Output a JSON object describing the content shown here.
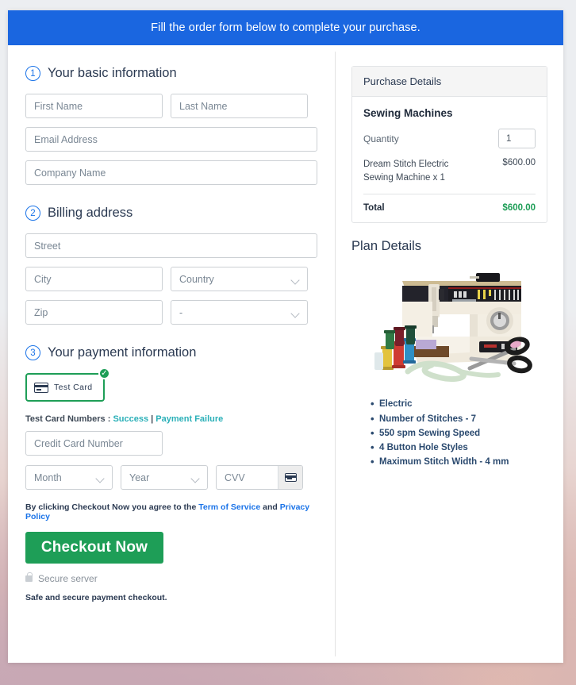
{
  "banner": {
    "text": "Fill the order form below to complete your purchase."
  },
  "sections": {
    "basic": {
      "number": "1",
      "title": "Your basic information"
    },
    "billing": {
      "number": "2",
      "title": "Billing address"
    },
    "payment": {
      "number": "3",
      "title": "Your payment information"
    }
  },
  "fields": {
    "first_name": "First Name",
    "last_name": "Last Name",
    "email": "Email Address",
    "company": "Company Name",
    "street": "Street",
    "city": "City",
    "country": "Country",
    "zip": "Zip",
    "state": "-",
    "credit_card": "Credit Card Number",
    "month": "Month",
    "year": "Year",
    "cvv": "CVV"
  },
  "payment": {
    "tile_label": "Test  Card",
    "tile_icon": "credit-card-icon",
    "badge_icon": "check-circle-icon",
    "test_numbers_label": "Test Card Numbers :",
    "link_success": "Success",
    "link_separator": "|",
    "link_failure": "Payment Failure",
    "cvv_icon": "credit-card-icon"
  },
  "terms": {
    "prefix": "By clicking Checkout Now you agree to the ",
    "tos": "Term of Service",
    "middle": " and ",
    "privacy": "Privacy Policy"
  },
  "actions": {
    "checkout": "Checkout Now",
    "secure_server": "Secure server",
    "secure_icon": "lock-icon",
    "safe_note": "Safe and secure payment checkout."
  },
  "purchase_details": {
    "header": "Purchase Details",
    "product_group": "Sewing Machines",
    "quantity_label": "Quantity",
    "quantity_value": "1",
    "line_item_name": "Dream Stitch Electric Sewing Machine x 1",
    "line_item_price": "$600.00",
    "total_label": "Total",
    "total_value": "$600.00"
  },
  "plan_details": {
    "title": "Plan Details",
    "image_name": "sewing-machine-photo",
    "features": [
      "Electric",
      "Number of Stitches - 7",
      "550 spm Sewing Speed",
      "4 Button Hole Styles",
      "Maximum Stitch Width - 4 mm"
    ]
  },
  "colors": {
    "banner_blue": "#1a66e0",
    "accent_blue": "#1a73e8",
    "success_green": "#1e9e57",
    "link_teal": "#2bb0b8",
    "heading_navy": "#2b3a52",
    "feature_blue": "#2b4a6f"
  }
}
